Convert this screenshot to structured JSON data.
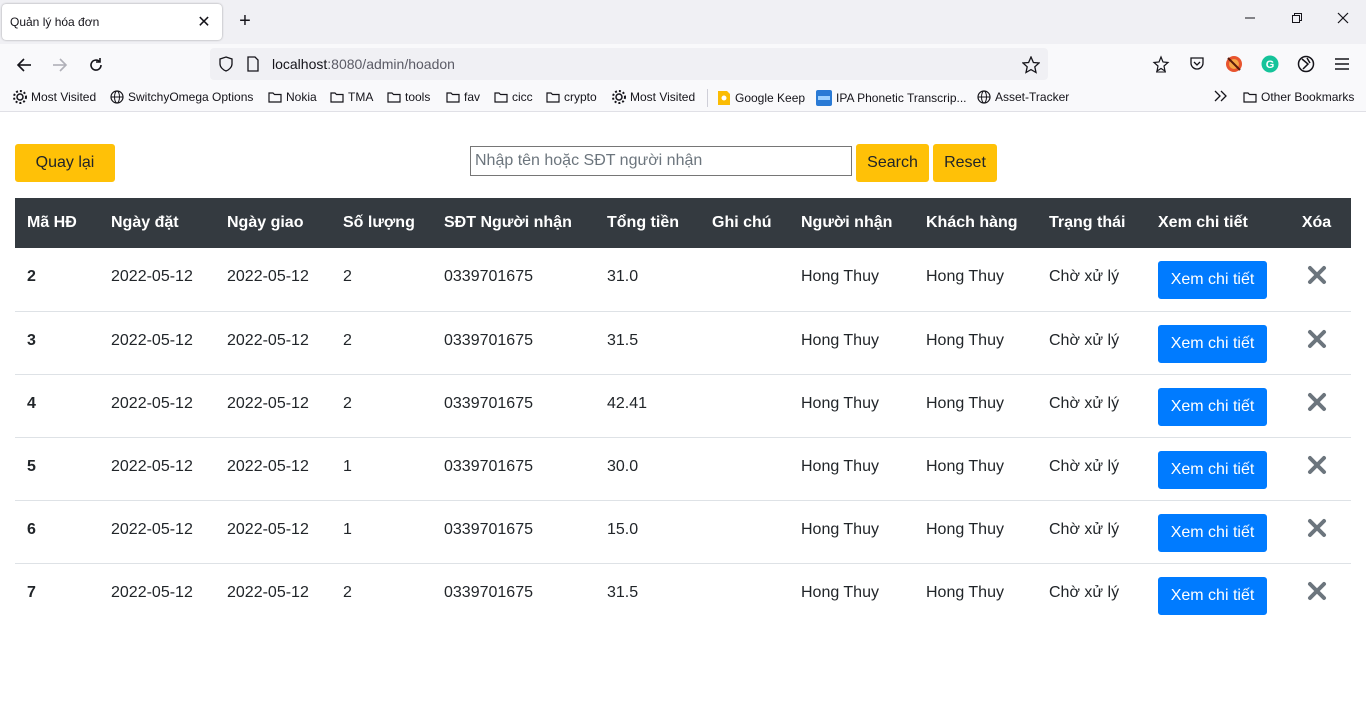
{
  "browser": {
    "tab_title": "Quản lý hóa đơn",
    "url_host": "localhost",
    "url_rest": ":8080/admin/hoadon",
    "bookmarks": [
      {
        "label": "Most Visited",
        "icon": "gear-icon"
      },
      {
        "label": "SwitchyOmega Options",
        "icon": "globe-icon"
      },
      {
        "label": "Nokia",
        "icon": "folder-icon"
      },
      {
        "label": "TMA",
        "icon": "folder-icon"
      },
      {
        "label": "tools",
        "icon": "folder-icon"
      },
      {
        "label": "fav",
        "icon": "folder-icon"
      },
      {
        "label": "cicc",
        "icon": "folder-icon"
      },
      {
        "label": "crypto",
        "icon": "folder-icon"
      },
      {
        "label": "Most Visited",
        "icon": "gear-icon"
      },
      {
        "label": "Google Keep",
        "icon": "keep-icon"
      },
      {
        "label": "IPA Phonetic Transcrip...",
        "icon": "ipa-icon"
      },
      {
        "label": "Asset-Tracker",
        "icon": "globe-icon"
      }
    ],
    "other_bookmarks": "Other Bookmarks"
  },
  "toolbar": {
    "back_label": "Quay lại",
    "search_placeholder": "Nhập tên hoặc SĐT người nhận",
    "search_label": "Search",
    "reset_label": "Reset"
  },
  "table": {
    "headers": [
      "Mã HĐ",
      "Ngày đặt",
      "Ngày giao",
      "Số lượng",
      "SĐT Người nhận",
      "Tổng tiền",
      "Ghi chú",
      "Người nhận",
      "Khách hàng",
      "Trạng thái",
      "Xem chi tiết",
      "Xóa"
    ],
    "detail_label": "Xem chi tiết",
    "rows": [
      {
        "id": "2",
        "order_date": "2022-05-12",
        "ship_date": "2022-05-12",
        "qty": "2",
        "phone": "0339701675",
        "total": "31.0",
        "note": "",
        "receiver": "Hong Thuy",
        "customer": "Hong Thuy",
        "status": "Chờ xử lý"
      },
      {
        "id": "3",
        "order_date": "2022-05-12",
        "ship_date": "2022-05-12",
        "qty": "2",
        "phone": "0339701675",
        "total": "31.5",
        "note": "",
        "receiver": "Hong Thuy",
        "customer": "Hong Thuy",
        "status": "Chờ xử lý"
      },
      {
        "id": "4",
        "order_date": "2022-05-12",
        "ship_date": "2022-05-12",
        "qty": "2",
        "phone": "0339701675",
        "total": "42.41",
        "note": "",
        "receiver": "Hong Thuy",
        "customer": "Hong Thuy",
        "status": "Chờ xử lý"
      },
      {
        "id": "5",
        "order_date": "2022-05-12",
        "ship_date": "2022-05-12",
        "qty": "1",
        "phone": "0339701675",
        "total": "30.0",
        "note": "",
        "receiver": "Hong Thuy",
        "customer": "Hong Thuy",
        "status": "Chờ xử lý"
      },
      {
        "id": "6",
        "order_date": "2022-05-12",
        "ship_date": "2022-05-12",
        "qty": "1",
        "phone": "0339701675",
        "total": "15.0",
        "note": "",
        "receiver": "Hong Thuy",
        "customer": "Hong Thuy",
        "status": "Chờ xử lý"
      },
      {
        "id": "7",
        "order_date": "2022-05-12",
        "ship_date": "2022-05-12",
        "qty": "2",
        "phone": "0339701675",
        "total": "31.5",
        "note": "",
        "receiver": "Hong Thuy",
        "customer": "Hong Thuy",
        "status": "Chờ xử lý"
      }
    ]
  },
  "colors": {
    "warning": "#ffc107",
    "primary": "#007bff",
    "table_header": "#343a40",
    "delete_icon": "#6c757d"
  }
}
